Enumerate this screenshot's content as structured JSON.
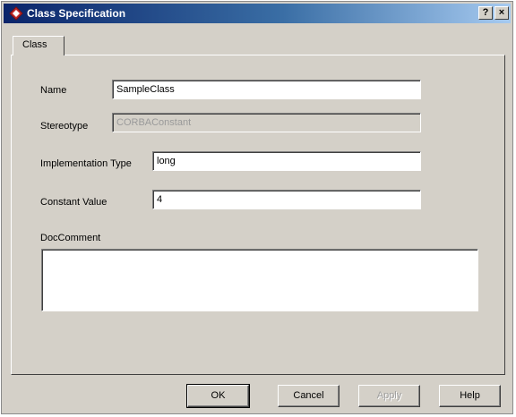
{
  "window": {
    "title": "Class Specification",
    "help_glyph": "?",
    "close_glyph": "×"
  },
  "tabs": [
    {
      "label": "Class",
      "selected": true
    }
  ],
  "form": {
    "name": {
      "label": "Name",
      "value": "SampleClass"
    },
    "stereotype": {
      "label": "Stereotype",
      "value": "CORBAConstant",
      "disabled": true
    },
    "implementation_type": {
      "label": "Implementation Type",
      "value": "long"
    },
    "constant_value": {
      "label": "Constant Value",
      "value": "4"
    },
    "doc_comment": {
      "label": "DocComment",
      "value": ""
    }
  },
  "buttons": {
    "ok": "OK",
    "cancel": "Cancel",
    "apply": "Apply",
    "help": "Help"
  },
  "colors": {
    "dialog_face": "#d4d0c8",
    "titlebar_start": "#0a246a",
    "titlebar_end": "#a6caf0",
    "app_icon": "#c0282a"
  }
}
